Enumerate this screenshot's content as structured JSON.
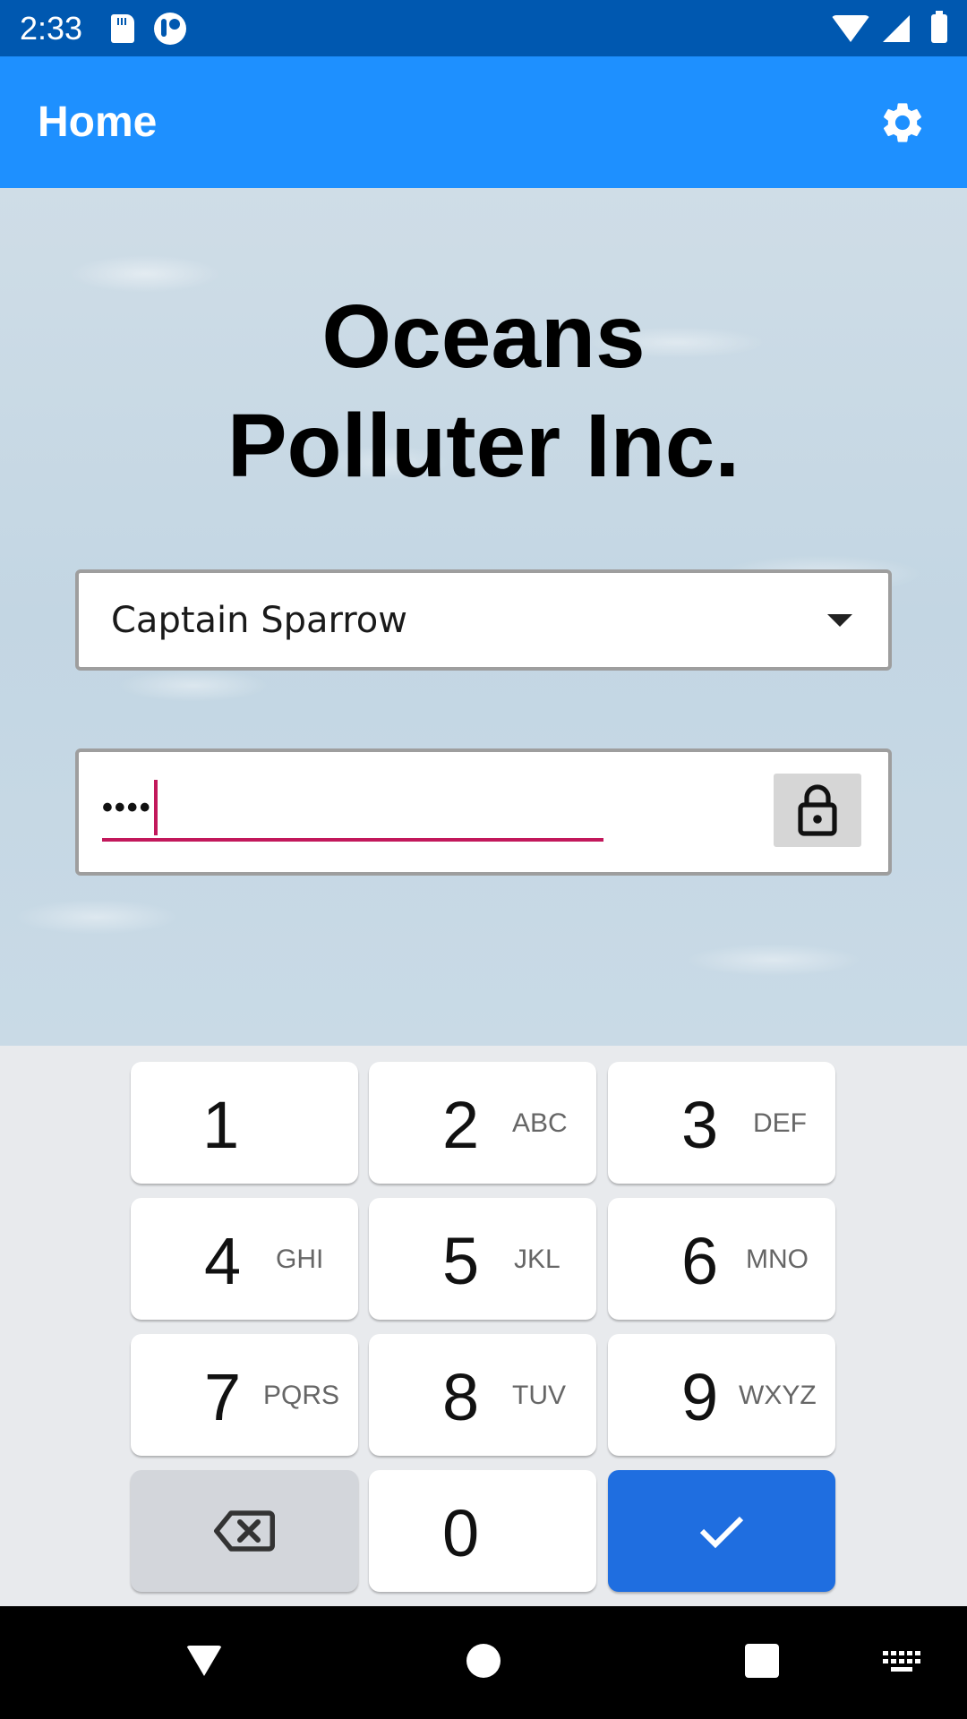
{
  "status_bar": {
    "time": "2:33"
  },
  "app_bar": {
    "title": "Home",
    "settings_icon": "gear-icon"
  },
  "main": {
    "headline_line1": "Oceans",
    "headline_line2": "Polluter Inc.",
    "user_select": {
      "value": "Captain Sparrow"
    },
    "password": {
      "value": "••••",
      "lock_icon": "lock-icon"
    }
  },
  "keyboard": {
    "keys": [
      {
        "digit": "1",
        "letters": ""
      },
      {
        "digit": "2",
        "letters": "ABC"
      },
      {
        "digit": "3",
        "letters": "DEF"
      },
      {
        "digit": "4",
        "letters": "GHI"
      },
      {
        "digit": "5",
        "letters": "JKL"
      },
      {
        "digit": "6",
        "letters": "MNO"
      },
      {
        "digit": "7",
        "letters": "PQRS"
      },
      {
        "digit": "8",
        "letters": "TUV"
      },
      {
        "digit": "9",
        "letters": "WXYZ"
      },
      {
        "digit": "0",
        "letters": ""
      }
    ],
    "delete_icon": "backspace-icon",
    "done_icon": "checkmark-icon"
  },
  "colors": {
    "status_bar": "#0058b0",
    "app_bar": "#1e90ff",
    "accent": "#c2185b",
    "done_key": "#1f6ee0"
  }
}
